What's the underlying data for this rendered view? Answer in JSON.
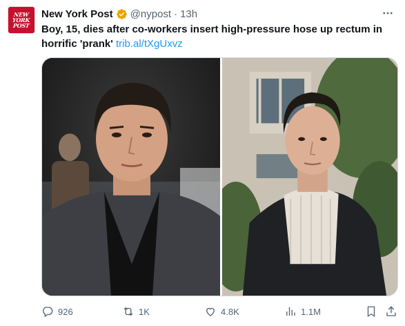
{
  "account": {
    "logo_lines": [
      "NEW",
      "YORK",
      "POST"
    ],
    "name": "New York Post",
    "handle": "@nypost",
    "separator": "·",
    "time": "13h",
    "verified_color": "#e8a400"
  },
  "tweet": {
    "text": "Boy, 15, dies after co-workers insert high-pressure hose up rectum in horrific 'prank' ",
    "link": "trib.al/tXgUxvz"
  },
  "actions": {
    "replies": "926",
    "retweets": "1K",
    "likes": "4.8K",
    "views": "1.1M"
  },
  "colors": {
    "accent": "#1d9bf0",
    "brand": "#c8102e",
    "muted": "#536471"
  },
  "icons": [
    "verified-badge-icon",
    "more-icon",
    "reply-icon",
    "retweet-icon",
    "like-icon",
    "views-icon",
    "bookmark-icon",
    "share-icon"
  ]
}
